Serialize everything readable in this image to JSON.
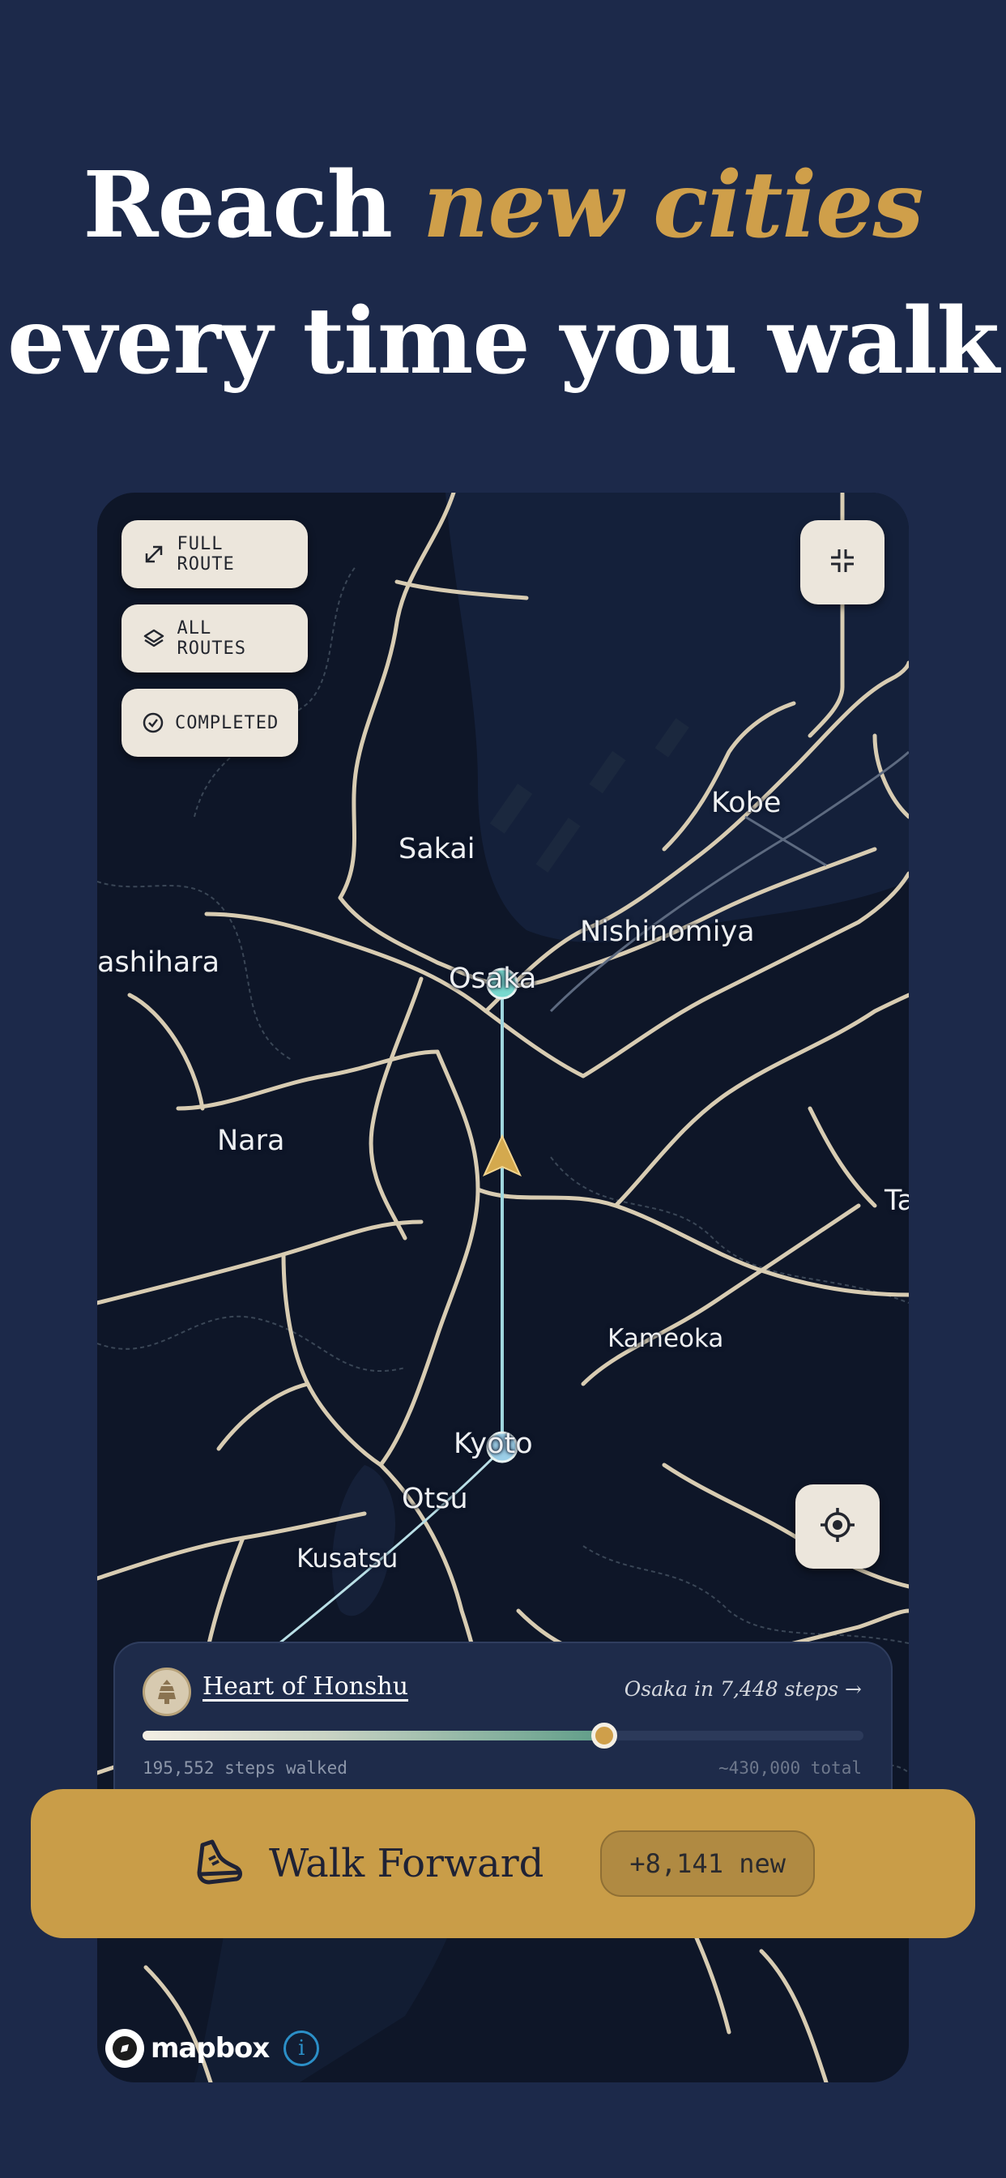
{
  "headline": {
    "line1_plain": "Reach",
    "line1_accent": "new cities",
    "line2": "every time you walk"
  },
  "map": {
    "chips": {
      "full_route": "FULL ROUTE",
      "all_routes": "ALL ROUTES",
      "completed": "COMPLETED"
    },
    "labels": {
      "kobe": "Kobe",
      "sakai": "Sakai",
      "nishinomiya": "Nishinomiya",
      "kashihara": "ashihara",
      "osaka": "Osaka",
      "nara": "Nara",
      "ta": "Ta",
      "kameoka": "Kameoka",
      "kyoto": "Kyoto",
      "otsu": "Otsu",
      "kusatsu": "Kusatsu"
    },
    "attribution": "mapbox",
    "info_glyph": "i"
  },
  "progress": {
    "route_name": "Heart of Honshu",
    "next_city": "Osaka in 7,448 steps →",
    "steps_walked": "195,552 steps walked",
    "steps_total": "~430,000 total",
    "fraction": 0.64
  },
  "cta": {
    "label": "Walk Forward",
    "new_steps": "+8,141 new"
  },
  "colors": {
    "background": "#1c294a",
    "accent": "#cf9f4a",
    "route_line": "#9fd6de",
    "button": "#c99d48"
  },
  "icons": [
    "expand-icon",
    "layers-icon",
    "check-circle-icon",
    "collapse-icon",
    "locate-icon",
    "shoe-icon",
    "badge-icon",
    "mapbox-logo-icon",
    "info-icon",
    "arrow-marker-icon"
  ]
}
